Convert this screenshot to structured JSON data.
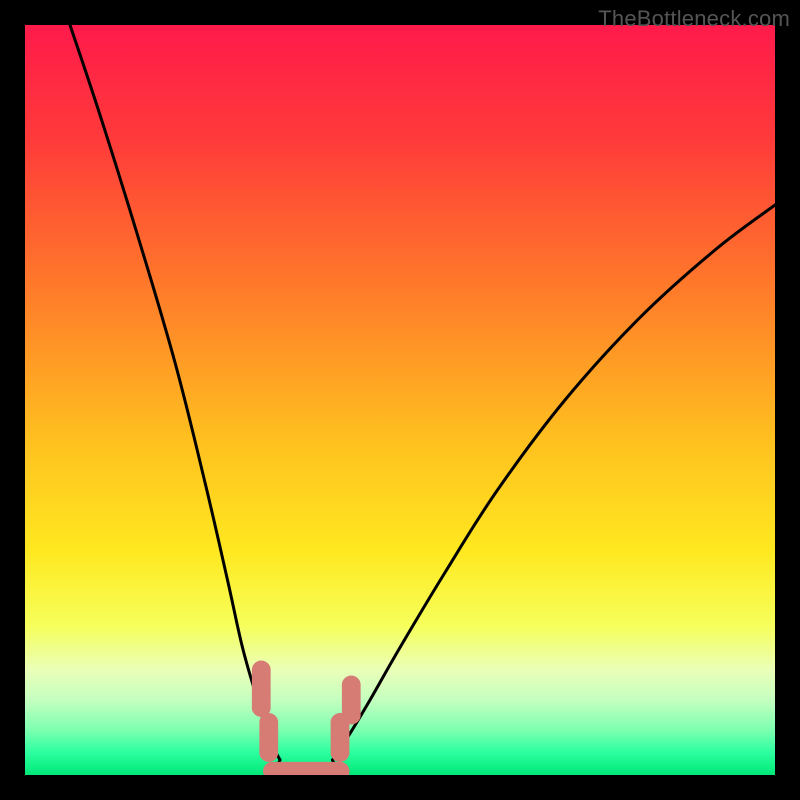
{
  "watermark": "TheBottleneck.com",
  "chart_data": {
    "type": "line",
    "title": "",
    "xlabel": "",
    "ylabel": "",
    "xlim": [
      0,
      100
    ],
    "ylim": [
      0,
      100
    ],
    "gradient_stops": [
      {
        "offset": 0.0,
        "color": "#ff1a4b"
      },
      {
        "offset": 0.15,
        "color": "#ff3a3a"
      },
      {
        "offset": 0.35,
        "color": "#ff7a2a"
      },
      {
        "offset": 0.55,
        "color": "#ffbf1f"
      },
      {
        "offset": 0.7,
        "color": "#ffe81f"
      },
      {
        "offset": 0.8,
        "color": "#f6ff5a"
      },
      {
        "offset": 0.86,
        "color": "#eaffb8"
      },
      {
        "offset": 0.9,
        "color": "#c4ffbf"
      },
      {
        "offset": 0.94,
        "color": "#7dffb0"
      },
      {
        "offset": 0.97,
        "color": "#2cff9f"
      },
      {
        "offset": 1.0,
        "color": "#00e878"
      }
    ],
    "series": [
      {
        "name": "left-branch",
        "x": [
          6,
          10,
          15,
          20,
          24,
          27,
          29,
          31,
          32.5,
          34
        ],
        "values": [
          100,
          88,
          72,
          55,
          39,
          26,
          17,
          10,
          5,
          2
        ]
      },
      {
        "name": "right-branch",
        "x": [
          41,
          43,
          46,
          50,
          56,
          63,
          72,
          82,
          92,
          100
        ],
        "values": [
          2,
          5,
          10,
          17,
          27,
          38,
          50,
          61,
          70,
          76
        ]
      }
    ],
    "valley_floor": {
      "x_start": 33,
      "x_end": 42,
      "y": 0
    },
    "marker_band": {
      "color": "#d77b75",
      "thickness": 2.5,
      "left_segments": [
        {
          "x": 31.5,
          "y1": 14,
          "y2": 9
        },
        {
          "x": 32.5,
          "y1": 7,
          "y2": 3
        }
      ],
      "right_segments": [
        {
          "x": 42.0,
          "y1": 3,
          "y2": 7
        },
        {
          "x": 43.5,
          "y1": 8,
          "y2": 12
        }
      ],
      "floor": {
        "x1": 33,
        "x2": 42,
        "y": 0.5
      }
    }
  }
}
